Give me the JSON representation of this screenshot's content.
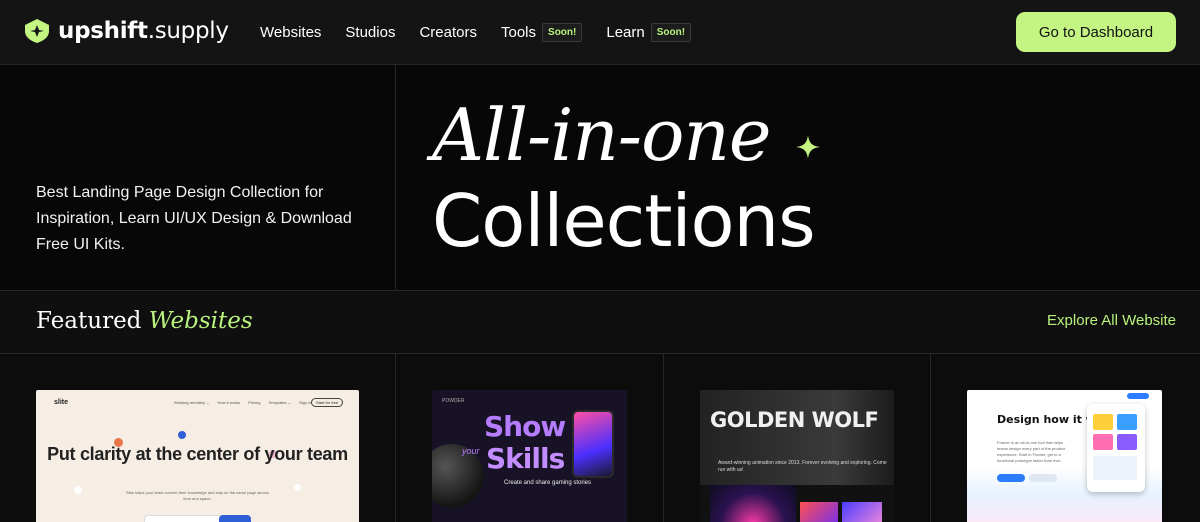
{
  "nav": {
    "brand_bold": "upshift",
    "brand_rest": ".supply",
    "links": [
      {
        "label": "Websites",
        "badge": ""
      },
      {
        "label": "Studios",
        "badge": ""
      },
      {
        "label": "Creators",
        "badge": ""
      },
      {
        "label": "Tools",
        "badge": "Soon!"
      },
      {
        "label": "Learn",
        "badge": "Soon!"
      }
    ],
    "dashboard_button": "Go to Dashboard"
  },
  "hero": {
    "tagline": "Best Landing Page Design Collection for Inspiration, Learn UI/UX Design & Download Free UI Kits.",
    "line1": "All-in-one",
    "line2": "Collections"
  },
  "featured": {
    "title_plain": "Featured",
    "title_accent": "Websites",
    "explore_link": "Explore All Website"
  },
  "cards": [
    {
      "logo": "slite",
      "nav": [
        "Working remotely ⌄",
        "How it works",
        "Pricing",
        "Templates ⌄",
        "Sign in"
      ],
      "cta": "Start for free",
      "headline": "Put clarity at the center of your team",
      "sub": "Slite helps your team convert their knowledge and stay on the same page across time and space."
    },
    {
      "small": "POWDER",
      "word1": "Show",
      "word_small": "your",
      "word2": "Skills",
      "caption": "Create and share gaming stories"
    },
    {
      "title": "GOLDEN WOLF",
      "caption": "Award-winning animation since 2013. Forever evolving and exploring. Come run with us!"
    },
    {
      "headline": "Design how it works.",
      "text": "Framer is an all-in-one tool that helps teams design every part of the product experience. Start in Framer, get to a functional prototype faster than ever."
    }
  ],
  "colors": {
    "accent": "#c4f582",
    "accent_text": "#b8f27c",
    "background": "#0c0c0c"
  }
}
